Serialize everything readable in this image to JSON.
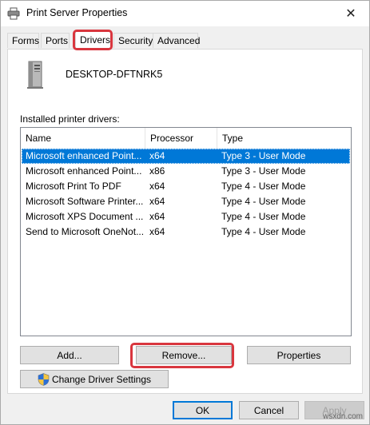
{
  "window": {
    "title": "Print Server Properties"
  },
  "tabs": [
    {
      "label": "Forms"
    },
    {
      "label": "Ports"
    },
    {
      "label": "Drivers"
    },
    {
      "label": "Security"
    },
    {
      "label": "Advanced"
    }
  ],
  "server": {
    "name": "DESKTOP-DFTNRK5"
  },
  "drivers": {
    "label": "Installed printer drivers:",
    "columns": [
      "Name",
      "Processor",
      "Type"
    ],
    "rows": [
      {
        "name": "Microsoft enhanced Point...",
        "processor": "x64",
        "type": "Type 3 - User Mode"
      },
      {
        "name": "Microsoft enhanced Point...",
        "processor": "x86",
        "type": "Type 3 - User Mode"
      },
      {
        "name": "Microsoft Print To PDF",
        "processor": "x64",
        "type": "Type 4 - User Mode"
      },
      {
        "name": "Microsoft Software Printer...",
        "processor": "x64",
        "type": "Type 4 - User Mode"
      },
      {
        "name": "Microsoft XPS Document ...",
        "processor": "x64",
        "type": "Type 4 - User Mode"
      },
      {
        "name": "Send to Microsoft OneNot...",
        "processor": "x64",
        "type": "Type 4 - User Mode"
      }
    ]
  },
  "buttons": {
    "add": "Add...",
    "remove": "Remove...",
    "properties": "Properties",
    "change_driver_settings": "Change Driver Settings",
    "ok": "OK",
    "cancel": "Cancel",
    "apply": "Apply"
  },
  "watermark": "wsxdn.com",
  "colors": {
    "selection": "#0078d7",
    "highlight": "#d9363e"
  }
}
